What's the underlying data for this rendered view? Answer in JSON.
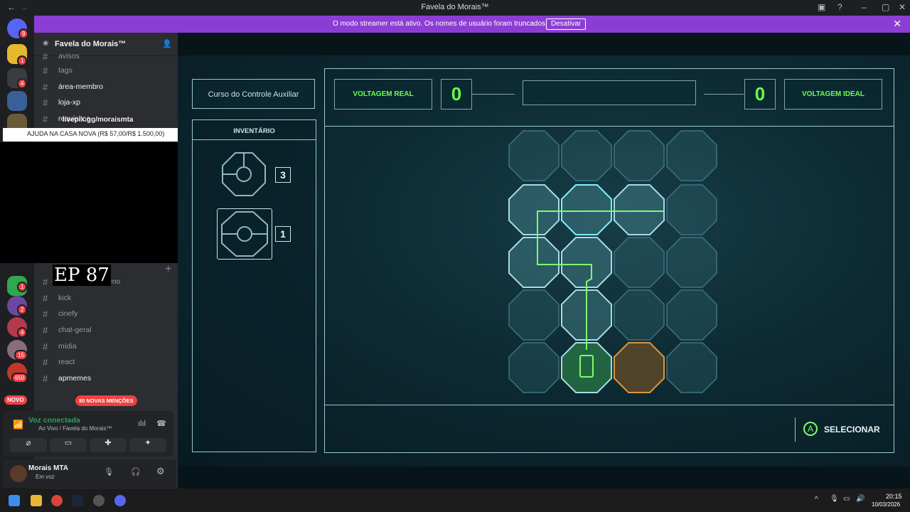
{
  "window": {
    "title": "Favela do Morais™"
  },
  "banner": {
    "message": "O modo streamer está ativo. Os nomes de usuário foram truncados.",
    "button": "Desativar"
  },
  "servers": {
    "badges": [
      "9",
      "1",
      "4",
      "1",
      "2",
      "4",
      "15",
      "650"
    ],
    "new_label": "NOVO",
    "mentions": "80 NOVAS MENÇÕES"
  },
  "guild": {
    "name": "Favela do Morais™"
  },
  "channels": [
    {
      "label": "avisos"
    },
    {
      "label": "tags"
    },
    {
      "label": "área-membro",
      "bold": true
    },
    {
      "label": "loja-xp",
      "bold": true
    },
    {
      "label": "requisitos",
      "bold": true
    },
    {
      "label": "momo"
    },
    {
      "label": "kick"
    },
    {
      "label": "cinefy"
    },
    {
      "label": "chat-geral"
    },
    {
      "label": "mídia"
    },
    {
      "label": "react"
    },
    {
      "label": "apmemes",
      "bold": true
    }
  ],
  "overlay": {
    "link": "livepix.gg/moraismta",
    "bar": "AJUDA NA CASA NOVA (R$ 57,00/R$ 1.500,00)",
    "episode": "EP 87"
  },
  "voice": {
    "status": "Voz conectada",
    "channel": "Ao Vivo / Favela do Morais™"
  },
  "user": {
    "name": "Morais MTA",
    "status": "Em voz"
  },
  "game": {
    "course_title": "Curso do Controle Auxiliar",
    "inventory_label": "INVENTÁRIO",
    "inventory": [
      {
        "count": "3"
      },
      {
        "count": "1"
      }
    ],
    "voltage_real_label": "VOLTAGEM REAL",
    "voltage_real": "0",
    "voltage_ideal_label": "VOLTAGEM IDEAL",
    "voltage_ideal": "0",
    "select_key": "A",
    "select_label": "SELECIONAR"
  },
  "taskbar": {
    "time": "20:15",
    "date": "10/03/2026"
  }
}
